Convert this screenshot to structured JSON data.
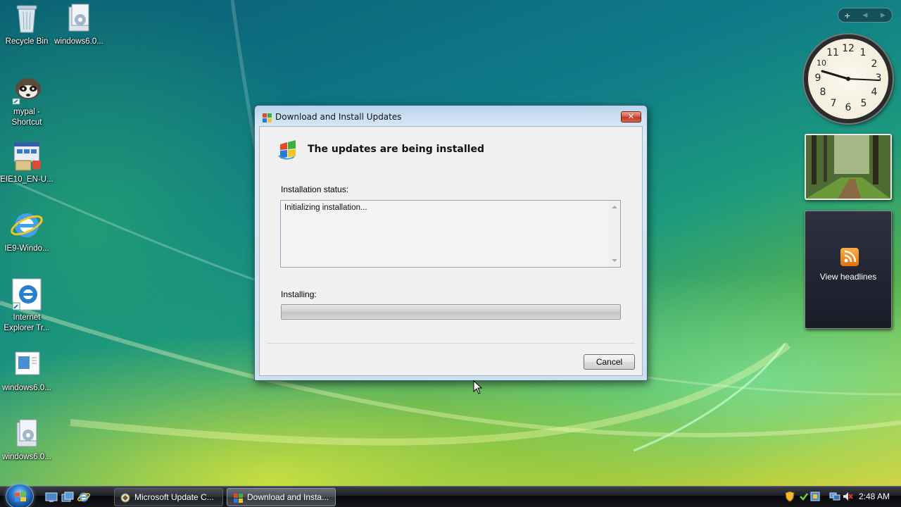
{
  "desktop": {
    "icons": [
      {
        "label": "Recycle Bin",
        "icon": "recycle-bin-icon"
      },
      {
        "label": "windows6.0...",
        "icon": "installer-package-icon"
      },
      {
        "label": "mypal - Shortcut",
        "icon": "raccoon-browser-icon"
      },
      {
        "label": "EIE10_EN-U...",
        "icon": "setup-program-icon"
      },
      {
        "label": "IE9-Windo...",
        "icon": "internet-explorer-icon"
      },
      {
        "label": "Internet Explorer Tr...",
        "icon": "internet-explorer-icon"
      },
      {
        "label": "windows6.0...",
        "icon": "update-file-icon"
      },
      {
        "label": "windows6.0...",
        "icon": "installer-package-icon"
      }
    ]
  },
  "gadgets": {
    "controls": {
      "add": "+",
      "prev": "◀",
      "next": "▶"
    },
    "clock": {
      "numbers": [
        "12",
        "1",
        "2",
        "3",
        "4",
        "5",
        "6",
        "7",
        "8",
        "9",
        "10",
        "11"
      ]
    },
    "feeds": {
      "label": "View headlines"
    }
  },
  "dialog": {
    "title": "Download and Install Updates",
    "close_label": "✕",
    "heading": "The updates are being installed",
    "status_label": "Installation status:",
    "status_text": "Initializing installation...",
    "installing_label": "Installing:",
    "progress_fraction": 0,
    "cancel_label": "Cancel"
  },
  "taskbar": {
    "tasks": [
      {
        "label": "Microsoft Update C...",
        "active": false
      },
      {
        "label": "Download and Insta...",
        "active": true
      }
    ],
    "clock": "2:48 AM"
  },
  "colors": {
    "dialog_frame": "#cde0ef",
    "taskbar": "#14161a",
    "close_button": "#c0351f"
  }
}
